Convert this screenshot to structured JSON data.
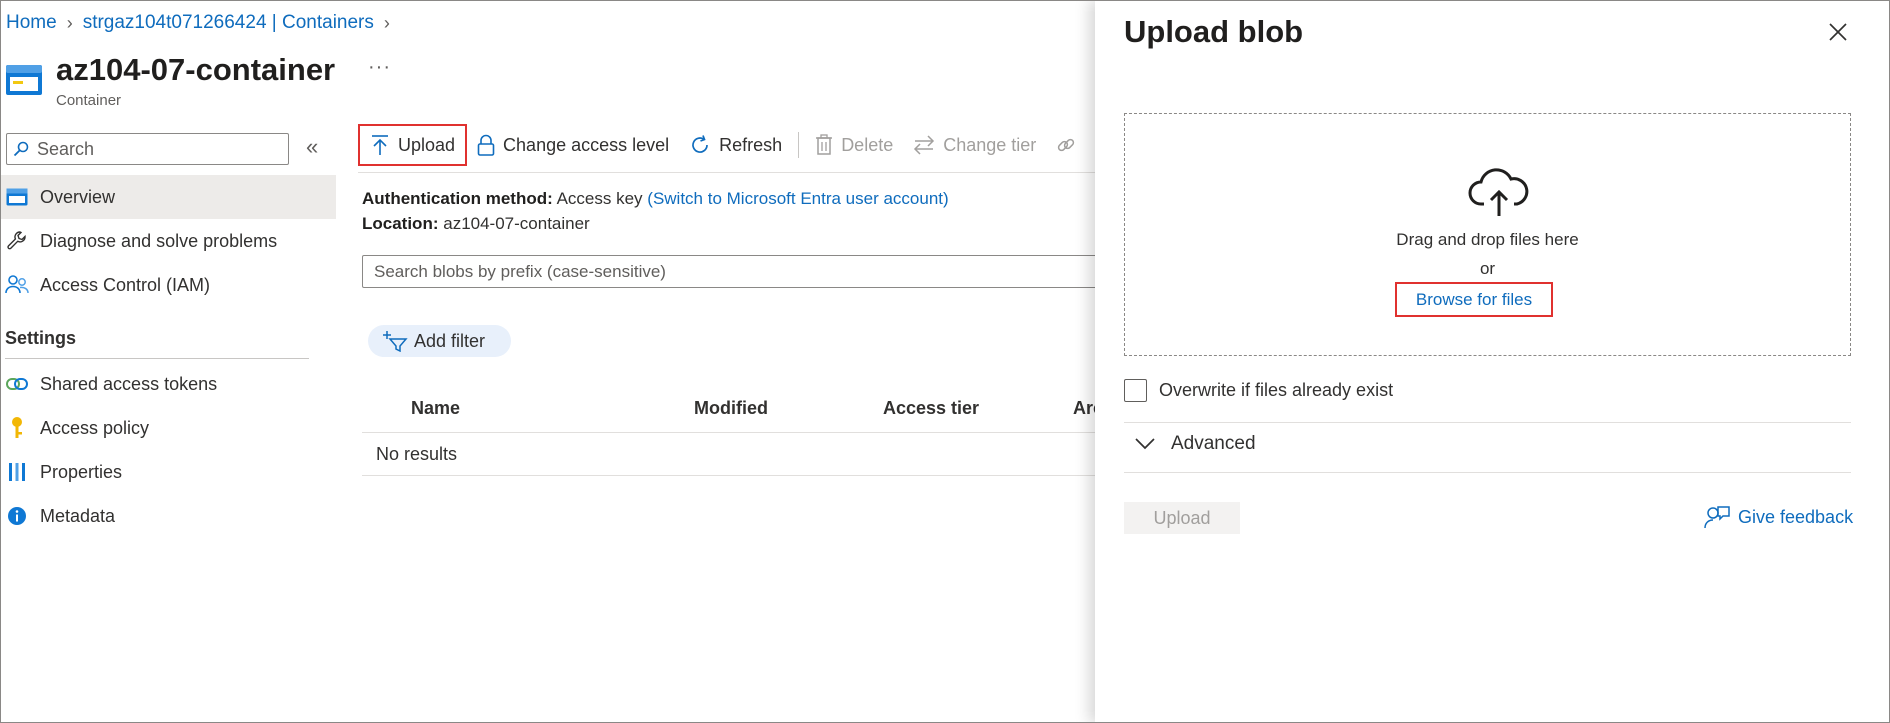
{
  "breadcrumb": {
    "home": "Home",
    "account": "strgaz104t071266424 | Containers"
  },
  "header": {
    "title": "az104-07-container",
    "subtitle": "Container",
    "more": "···"
  },
  "sidebar": {
    "search_placeholder": "Search",
    "collapse": "«",
    "items": [
      {
        "label": "Overview",
        "icon": "container-icon",
        "active": true
      },
      {
        "label": "Diagnose and solve problems",
        "icon": "wrench-icon"
      },
      {
        "label": "Access Control (IAM)",
        "icon": "people-icon"
      }
    ],
    "settings_heading": "Settings",
    "settings_items": [
      {
        "label": "Shared access tokens",
        "icon": "link-icon"
      },
      {
        "label": "Access policy",
        "icon": "key-icon"
      },
      {
        "label": "Properties",
        "icon": "properties-icon"
      },
      {
        "label": "Metadata",
        "icon": "info-icon"
      }
    ]
  },
  "toolbar": {
    "upload": "Upload",
    "change_access": "Change access level",
    "refresh": "Refresh",
    "delete": "Delete",
    "change_tier": "Change tier"
  },
  "info": {
    "auth_label": "Authentication method:",
    "auth_value": "Access key",
    "auth_link": "(Switch to Microsoft Entra user account)",
    "location_label": "Location:",
    "location_value": "az104-07-container"
  },
  "blob_search": {
    "placeholder": "Search blobs by prefix (case-sensitive)"
  },
  "add_filter": "Add filter",
  "table": {
    "columns": [
      "Name",
      "Modified",
      "Access tier",
      "Arc"
    ],
    "empty": "No results"
  },
  "panel": {
    "title": "Upload blob",
    "drag_text": "Drag and drop files here",
    "or_text": "or",
    "browse": "Browse for files",
    "overwrite": "Overwrite if files already exist",
    "advanced": "Advanced",
    "upload_button": "Upload",
    "feedback": "Give feedback"
  },
  "colors": {
    "link": "#0f6cbd",
    "highlight": "#e0312f",
    "disabled": "#a19f9d"
  }
}
